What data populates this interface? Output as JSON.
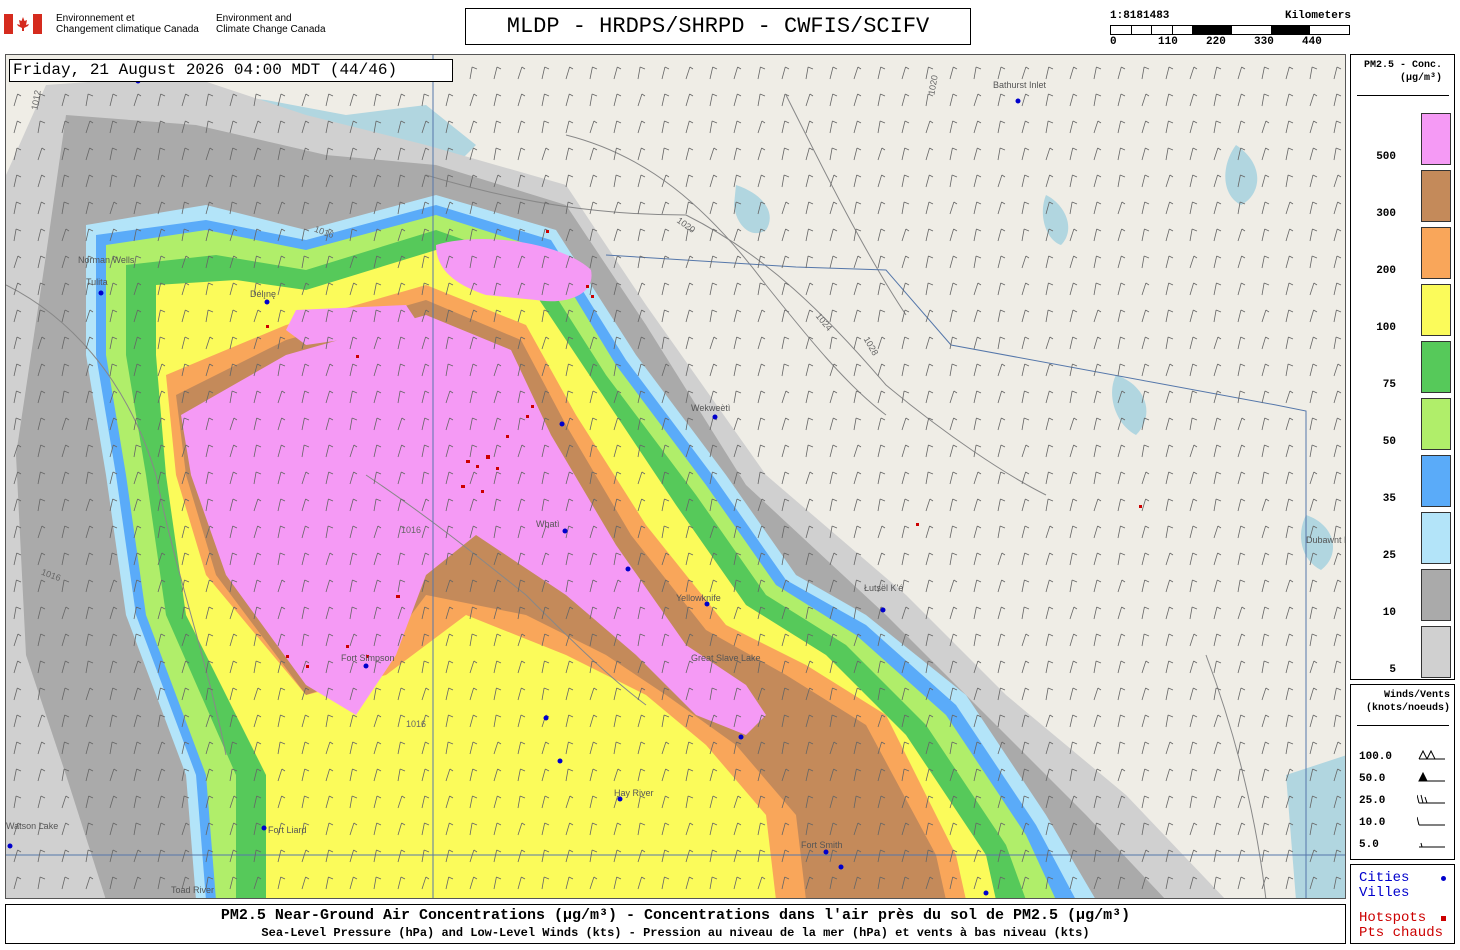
{
  "header": {
    "agency_fr": [
      "Environnement et",
      "Changement climatique Canada"
    ],
    "agency_en": [
      "Environment and",
      "Climate Change Canada"
    ],
    "title": "MLDP - HRDPS/SHRPD - CWFIS/SCIFV",
    "scale": {
      "ratio": "1:8181483",
      "unit": "Kilometers",
      "ticks": [
        "0",
        "110",
        "220",
        "330",
        "440"
      ]
    }
  },
  "map": {
    "timestamp": "Friday, 21 August 2026 04:00 MDT (44/46)",
    "places": [
      "Bathurst Inlet",
      "Norman Wells",
      "Tulita",
      "Délı̨nę",
      "Wekweètì",
      "Whatì",
      "Yellowknife",
      "Great Slave Lake",
      "Łutsël K'é",
      "Fort Simpson",
      "Hay River",
      "Fort Smith",
      "Fort Liard",
      "Watson Lake",
      "Toad River",
      "Dubawnt Lake"
    ],
    "isobar_labels": [
      "1012",
      "1016",
      "1020",
      "1024",
      "1028"
    ]
  },
  "legend": {
    "title_lines": [
      "PM2.5 - Conc.",
      "(µg/m³)"
    ],
    "entries": [
      {
        "label": "500",
        "color": "#f59af5"
      },
      {
        "label": "300",
        "color": "#c48a5a"
      },
      {
        "label": "200",
        "color": "#f9a65a"
      },
      {
        "label": "100",
        "color": "#fbfb5a"
      },
      {
        "label": "75",
        "color": "#56c95a"
      },
      {
        "label": "50",
        "color": "#b0ee6a"
      },
      {
        "label": "35",
        "color": "#5aabf9"
      },
      {
        "label": "25",
        "color": "#b3e4f9"
      },
      {
        "label": "10",
        "color": "#aaaaaa"
      },
      {
        "label": "5",
        "color": "#d0d0d0"
      }
    ]
  },
  "winds": {
    "title_lines": [
      "Winds/Vents",
      "(knots/noeuds)"
    ],
    "entries": [
      "100.0",
      "50.0",
      "25.0",
      "10.0",
      "5.0"
    ]
  },
  "keys": {
    "cities": [
      "Cities",
      "Villes"
    ],
    "hotspots": [
      "Hotspots",
      "Pts chauds"
    ],
    "city_color": "#0000cc",
    "hotspot_color": "#cc0000"
  },
  "footer": {
    "line1": "PM2.5 Near-Ground Air Concentrations (µg/m³) - Concentrations dans l'air près du sol de PM2.5 (µg/m³)",
    "line2": "Sea-Level Pressure (hPa) and Low-Level Winds (kts) - Pression au niveau de la mer (hPa) et vents à bas niveau (kts)"
  }
}
